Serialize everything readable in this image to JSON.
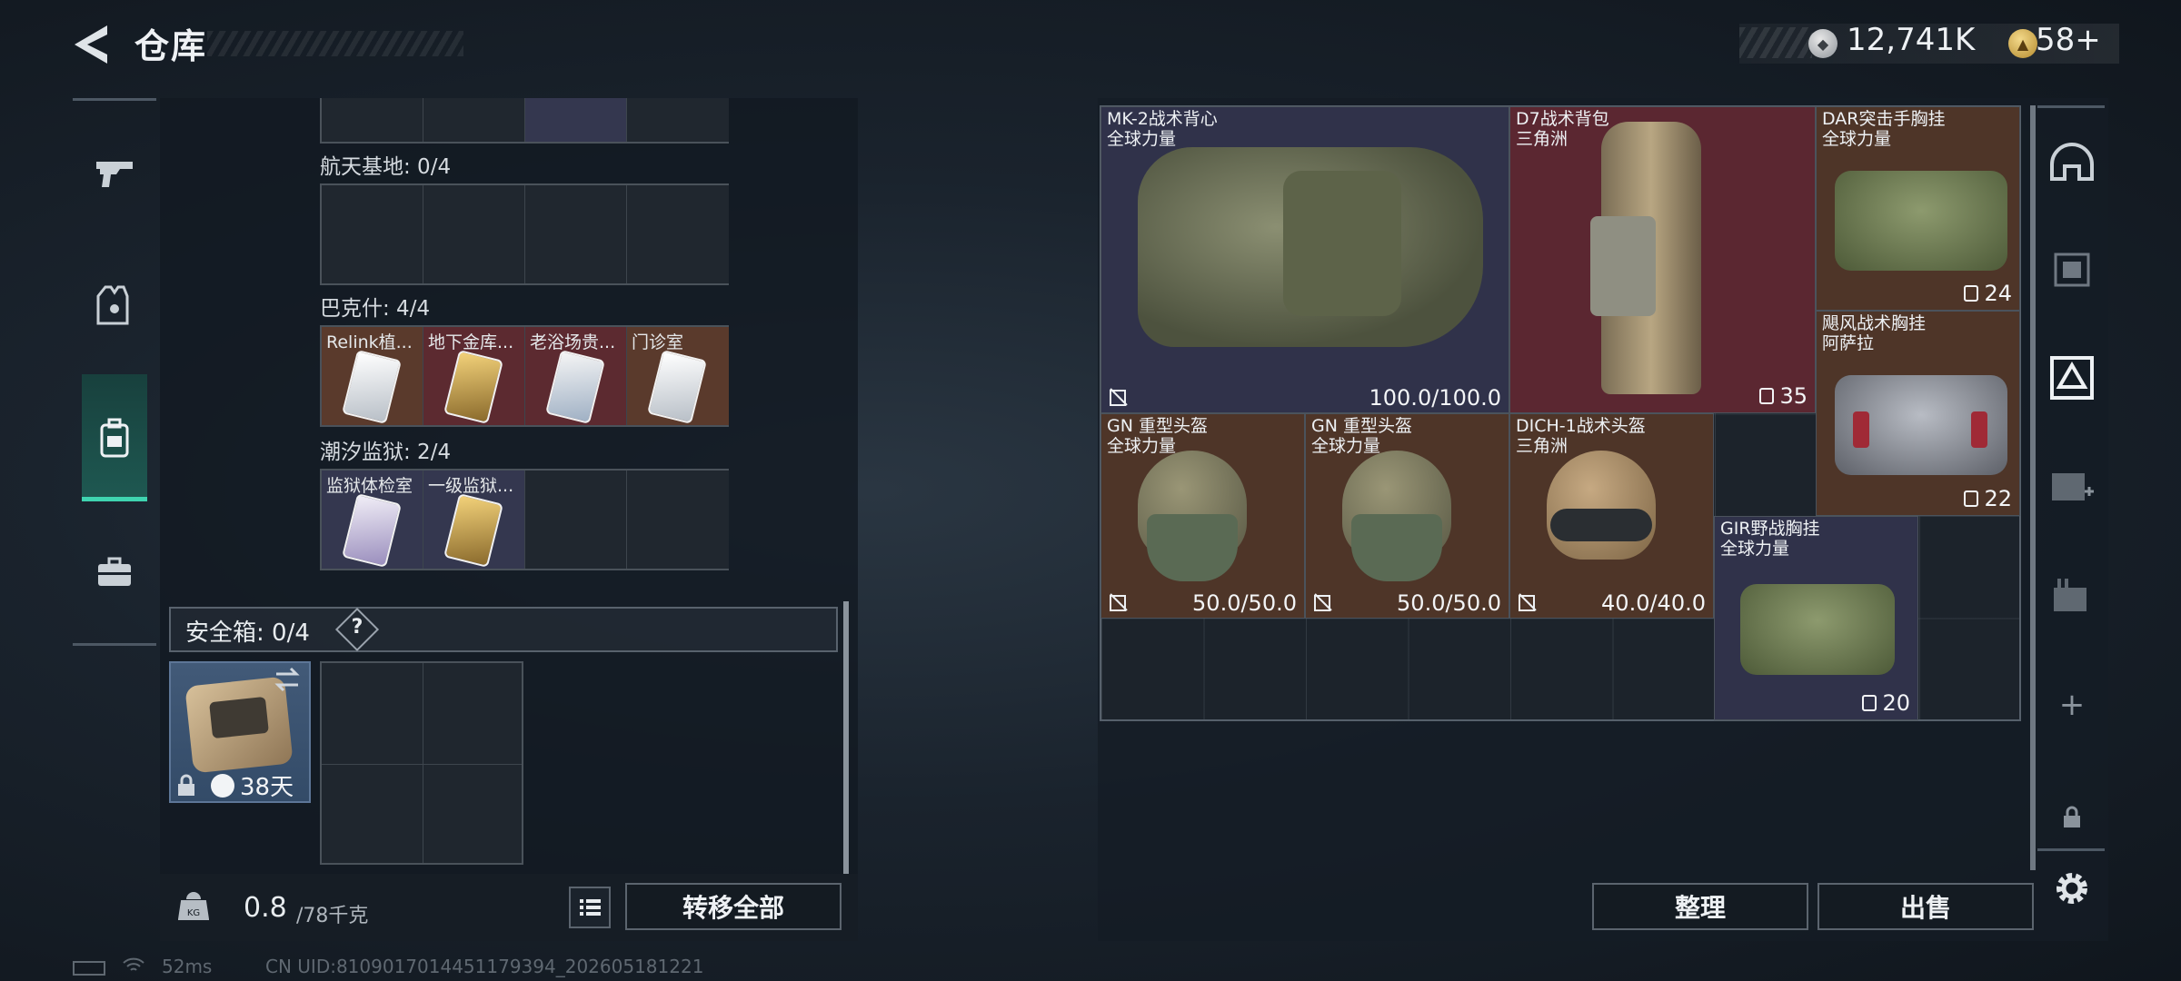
{
  "header": {
    "title": "仓库",
    "silver_amount": "12,741K",
    "gold_amount": "58+"
  },
  "left_nav": {
    "items": [
      {
        "name": "weapons",
        "icon": "gun-icon"
      },
      {
        "name": "equipment",
        "icon": "gear-vest-icon"
      },
      {
        "name": "storage",
        "icon": "backpack-icon",
        "active": true
      },
      {
        "name": "toolbox",
        "icon": "briefcase-icon"
      }
    ]
  },
  "keycards": {
    "sections": [
      {
        "label": "航天基地: 0/4",
        "cells": [
          "",
          "",
          "",
          ""
        ]
      },
      {
        "label": "巴克什: 4/4",
        "cells": [
          "Relink植...",
          "地下金库...",
          "老浴场贵...",
          "门诊室"
        ]
      },
      {
        "label": "潮汐监狱: 2/4",
        "cells": [
          "监狱体检室",
          "一级监狱...",
          "",
          ""
        ]
      }
    ]
  },
  "safebox": {
    "label": "安全箱: 0/4",
    "help": "?",
    "duration": "38天"
  },
  "weight": {
    "current": "0.8",
    "max": "/78千克"
  },
  "buttons": {
    "transfer_all": "转移全部",
    "sort": "整理",
    "sell": "出售"
  },
  "items": [
    {
      "name": "MK-2战术背心",
      "sub": "全球力量",
      "value": "100.0/100.0"
    },
    {
      "name": "D7战术背包",
      "sub": "三角洲",
      "value": "35"
    },
    {
      "name": "DAR突击手胸挂",
      "sub": "全球力量",
      "value": "24"
    },
    {
      "name": "飓风战术胸挂",
      "sub": "阿萨拉",
      "value": "22"
    },
    {
      "name": "GN 重型头盔",
      "sub": "全球力量",
      "value": "50.0/50.0"
    },
    {
      "name": "GN 重型头盔",
      "sub": "全球力量",
      "value": "50.0/50.0"
    },
    {
      "name": "DICH-1战术头盔",
      "sub": "三角洲",
      "value": "40.0/40.0"
    },
    {
      "name": "GIR野战胸挂",
      "sub": "全球力量",
      "value": "20"
    }
  ],
  "right_nav": {
    "items": [
      "helmet-slot-icon",
      "armor-rack-icon",
      "container-icon",
      "medkit-icon",
      "tools-icon",
      "plus-icon",
      "lock-icon",
      "settings-icon"
    ],
    "add_label": "+"
  },
  "footer": {
    "ping": "52ms",
    "uid": "CN UID:8109017014451179394_202605181221"
  },
  "colors": {
    "accent": "#3fd4b0",
    "rarity_purple": "#34374f",
    "rarity_red": "#5c2a30",
    "rarity_brown": "#5a3a2c"
  }
}
